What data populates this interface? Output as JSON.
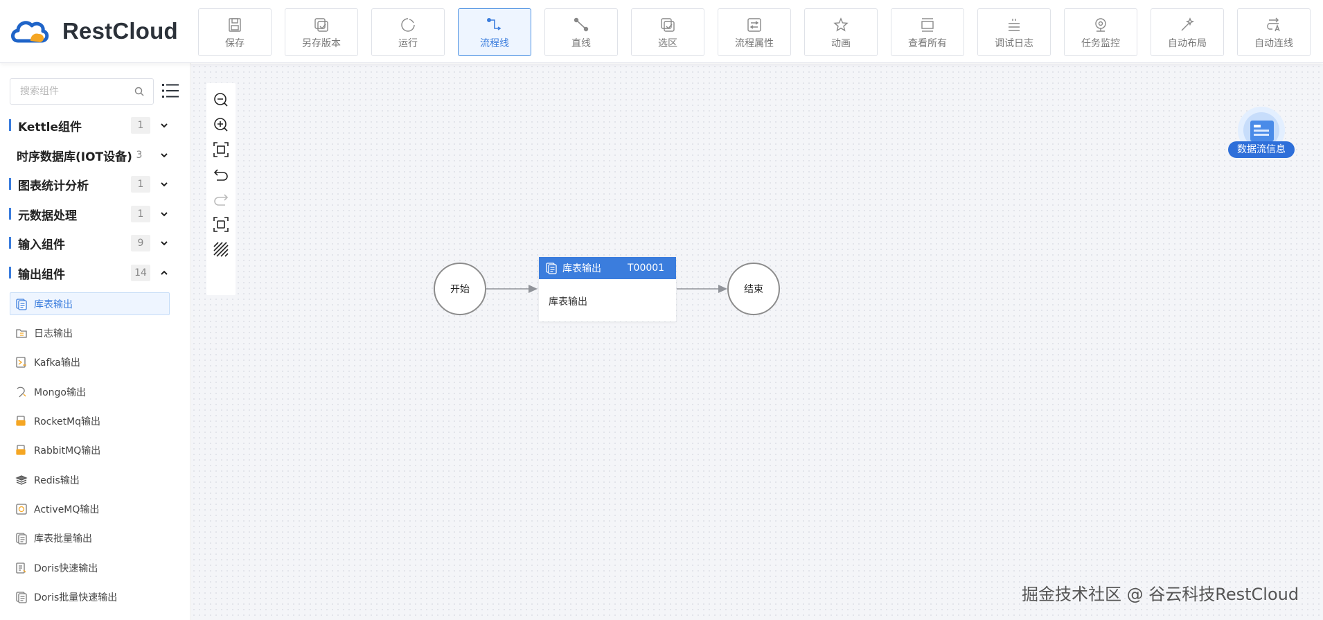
{
  "app": {
    "name": "RestCloud"
  },
  "toolbar": [
    {
      "label": "保存",
      "icon": "save-icon"
    },
    {
      "label": "另存版本",
      "icon": "save-version-icon"
    },
    {
      "label": "运行",
      "icon": "run-icon"
    },
    {
      "label": "流程线",
      "icon": "flow-line-icon",
      "active": true
    },
    {
      "label": "直线",
      "icon": "straight-line-icon"
    },
    {
      "label": "选区",
      "icon": "select-area-icon"
    },
    {
      "label": "流程属性",
      "icon": "flow-properties-icon"
    },
    {
      "label": "动画",
      "icon": "animation-icon"
    },
    {
      "label": "查看所有",
      "icon": "view-all-icon"
    },
    {
      "label": "调试日志",
      "icon": "debug-log-icon"
    },
    {
      "label": "任务监控",
      "icon": "task-monitor-icon"
    },
    {
      "label": "自动布局",
      "icon": "auto-layout-icon"
    },
    {
      "label": "自动连线",
      "icon": "auto-connect-icon"
    }
  ],
  "sidebar": {
    "search_placeholder": "搜索组件",
    "categories": [
      {
        "label": "Kettle组件",
        "count": "1",
        "expanded": false
      },
      {
        "label": "时序数据库(IOT设备)",
        "count": "3",
        "expanded": false
      },
      {
        "label": "图表统计分析",
        "count": "1",
        "expanded": false
      },
      {
        "label": "元数据处理",
        "count": "1",
        "expanded": false
      },
      {
        "label": "输入组件",
        "count": "9",
        "expanded": false
      },
      {
        "label": "输出组件",
        "count": "14",
        "expanded": true
      }
    ],
    "items": [
      {
        "label": "库表输出",
        "selected": true
      },
      {
        "label": "日志输出"
      },
      {
        "label": "Kafka输出"
      },
      {
        "label": "Mongo输出"
      },
      {
        "label": "RocketMq输出"
      },
      {
        "label": "RabbitMQ输出"
      },
      {
        "label": "Redis输出"
      },
      {
        "label": "ActiveMQ输出"
      },
      {
        "label": "库表批量输出"
      },
      {
        "label": "Doris快速输出"
      },
      {
        "label": "Doris批量快速输出"
      }
    ]
  },
  "canvas": {
    "start_node": "开始",
    "end_node": "结束",
    "task": {
      "type_label": "库表输出",
      "id": "T00001",
      "name": "库表输出"
    },
    "info_badge": "数据流信息",
    "watermark": "掘金技术社区 @ 谷云科技RestCloud"
  },
  "colors": {
    "accent": "#3b7ddd",
    "canvas_bg": "#f4f5f8"
  }
}
